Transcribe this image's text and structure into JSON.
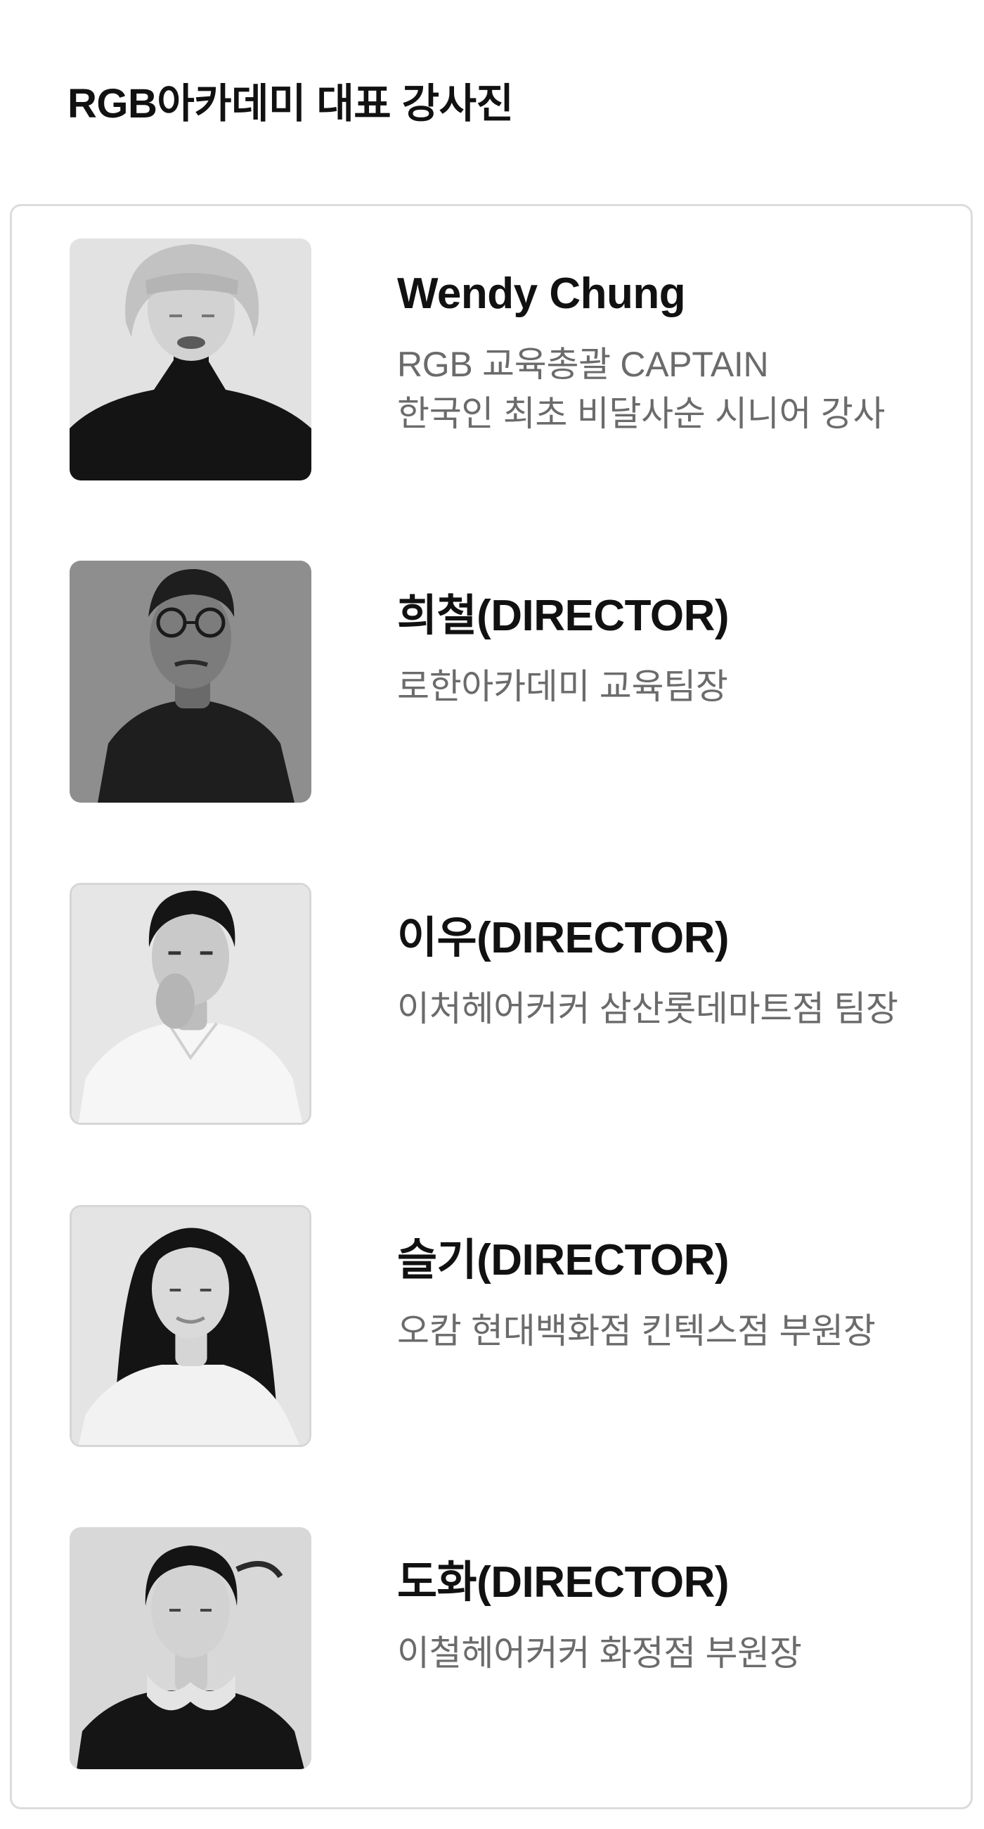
{
  "section": {
    "title": "RGB아카데미 대표 강사진"
  },
  "instructors": [
    {
      "name": "Wendy Chung",
      "description": [
        "RGB 교육총괄 CAPTAIN",
        "한국인 최초 비달사순 시니어 강사"
      ],
      "photo_icon": "portrait-woman-bob-hair"
    },
    {
      "name": "희철(DIRECTOR)",
      "description": [
        "로한아카데미 교육팀장"
      ],
      "photo_icon": "portrait-man-glasses"
    },
    {
      "name": "이우(DIRECTOR)",
      "description": [
        "이처헤어커커 삼산롯데마트점 팀장"
      ],
      "photo_icon": "portrait-man-white-shirt"
    },
    {
      "name": "슬기(DIRECTOR)",
      "description": [
        "오캄 현대백화점 킨텍스점 부원장"
      ],
      "photo_icon": "portrait-woman-long-hair"
    },
    {
      "name": "도화(DIRECTOR)",
      "description": [
        "이철헤어커커 화정점 부원장"
      ],
      "photo_icon": "portrait-woman-hands-chin"
    }
  ],
  "colors": {
    "title": "#111111",
    "description": "#6b6b6b",
    "card_border": "#dcdcdc"
  }
}
